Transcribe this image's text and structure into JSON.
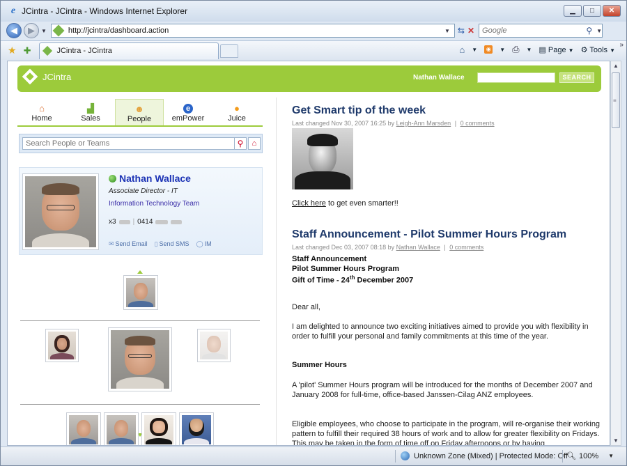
{
  "window": {
    "title": "JCintra - JCintra - Windows Internet Explorer",
    "url": "http://jcintra/dashboard.action",
    "search_placeholder": "Google",
    "tab_title": "JCintra - JCintra",
    "cmd_page": "Page",
    "cmd_tools": "Tools"
  },
  "app": {
    "logo_text": "JCintra",
    "user_name": "Nathan Wallace",
    "search_button": "SEARCH"
  },
  "nav": {
    "tabs": [
      {
        "label": "Home",
        "icon": "home-icon"
      },
      {
        "label": "Sales",
        "icon": "chart-icon"
      },
      {
        "label": "People",
        "icon": "people-icon"
      },
      {
        "label": "emPower",
        "icon": "empower-icon"
      },
      {
        "label": "Juice",
        "icon": "juice-icon"
      }
    ],
    "active": "People"
  },
  "people_search": {
    "placeholder": "Search People or Teams"
  },
  "profile": {
    "name": "Nathan Wallace",
    "title": "Associate Director - IT",
    "team": "Information Technology Team",
    "ext_prefix": "x3",
    "mobile_prefix": "0414",
    "send_email": "Send Email",
    "send_sms": "Send SMS",
    "im": "IM",
    "status_color": "#2a8b1a"
  },
  "posts": [
    {
      "title": "Get Smart tip of the week",
      "meta_prefix": "Last changed Nov 30, 2007 16:25 by",
      "author": "Leigh-Ann Marsden",
      "comments": "0 comments",
      "link_text": "Click here",
      "link_rest": " to get even smarter!!"
    },
    {
      "title": "Staff Announcement - Pilot Summer Hours Program",
      "meta_prefix": "Last changed Dec 03, 2007 08:18 by",
      "author": "Nathan Wallace",
      "comments": "0 comments",
      "heading1": "Staff Announcement",
      "heading2": "Pilot Summer Hours Program",
      "heading3_pre": "Gift of Time - 24",
      "heading3_sup": "th",
      "heading3_post": " December 2007",
      "greeting": "Dear all,",
      "para1": "I am delighted to announce two exciting initiatives aimed to provide you with flexibility in order to fulfill your personal and family commitments at this time of the year.",
      "subhead": "Summer Hours",
      "para2": "A 'pilot' Summer Hours program will be introduced for the months of December 2007 and January 2008 for full-time, office-based Janssen-Cilag ANZ employees.",
      "para3": "Eligible employees, who choose to participate in the program, will re-organise their working pattern to fulfill their required 38 hours of work and to allow for greater flexibility on Fridays.  This may be taken in the form of time off on Friday afternoons or by having"
    }
  ],
  "status": {
    "zone": "Unknown Zone (Mixed) | Protected Mode: Off",
    "zoom": "100%"
  }
}
